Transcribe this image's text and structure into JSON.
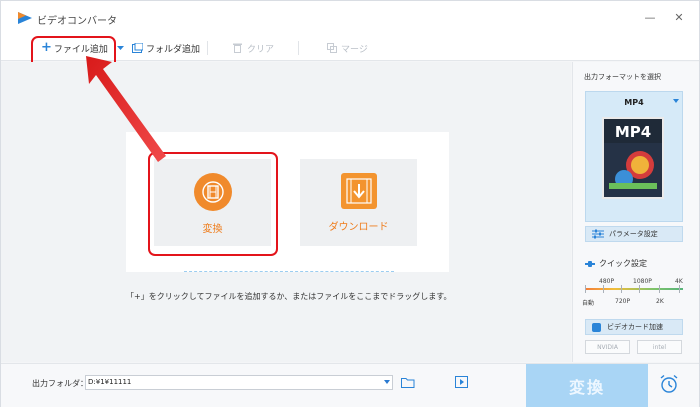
{
  "window": {
    "title": "ビデオコンバータ",
    "minimize_icon": "minimize-icon",
    "close_icon": "close-icon"
  },
  "toolbar": {
    "add_file": "ファイル追加",
    "add_folder": "フォルダ追加",
    "clear": "クリア",
    "merge": "マージ"
  },
  "main": {
    "convert_tile": "変換",
    "download_tile": "ダウンロード",
    "hint": "「+」をクリックしてファイルを追加するか、またはファイルをここまでドラッグします。"
  },
  "right_panel": {
    "output_format_title": "出力フォーマットを選択",
    "format_name": "MP4",
    "format_image_text": "MP4",
    "parameter_settings": "パラメータ設定",
    "quick_settings": "クイック設定",
    "quality_top": [
      "480P",
      "1080P",
      "4K"
    ],
    "quality_bottom": [
      "自動",
      "720P",
      "2K"
    ],
    "gpu_accel": "ビデオカード加速",
    "gpu_nvidia": "NVIDIA",
    "gpu_intel": "intel"
  },
  "bottom": {
    "output_folder_label": "出力フォルダ：",
    "output_folder_value": "D:¥1¥11111",
    "convert_button": "変換"
  },
  "colors": {
    "accent_orange": "#f08a2c",
    "highlight_red": "#e3141b",
    "convert_button_bg": "#a9d5f5",
    "link_blue": "#2a84d8"
  }
}
